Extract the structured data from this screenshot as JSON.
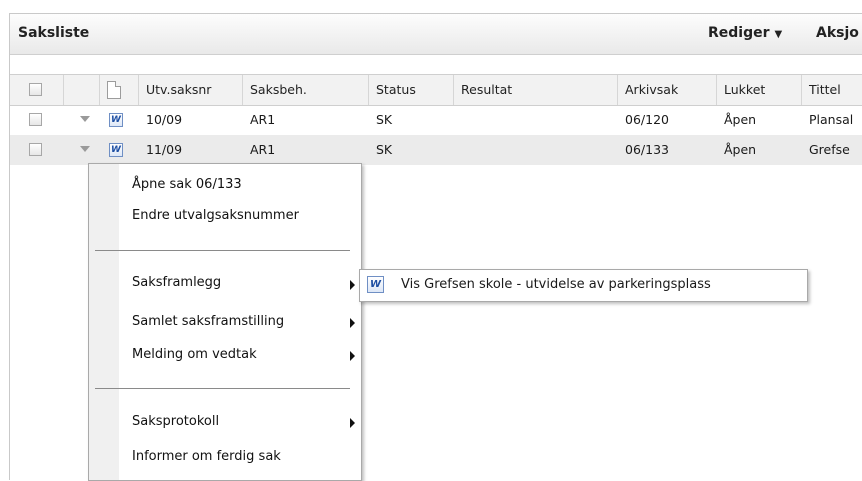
{
  "panel": {
    "title": "Saksliste",
    "menus": [
      {
        "label": "Rediger"
      },
      {
        "label": "Aksjo"
      }
    ]
  },
  "table": {
    "columns": [
      "Utv.saksnr",
      "Saksbeh.",
      "Status",
      "Resultat",
      "Arkivsak",
      "Lukket",
      "Tittel"
    ],
    "rows": [
      {
        "utvsaksnr": "10/09",
        "saksbeh": "AR1",
        "status": "SK",
        "resultat": "",
        "arkivsak": "06/120",
        "lukket": "Åpen",
        "tittel": "Plansal"
      },
      {
        "utvsaksnr": "11/09",
        "saksbeh": "AR1",
        "status": "SK",
        "resultat": "",
        "arkivsak": "06/133",
        "lukket": "Åpen",
        "tittel": "Grefse"
      }
    ]
  },
  "context_menu": {
    "items": [
      {
        "label": "Åpne sak 06/133"
      },
      {
        "label": "Endre utvalgsaksnummer"
      },
      {
        "label": "Saksframlegg"
      },
      {
        "label": "Samlet saksframstilling"
      },
      {
        "label": "Melding om vedtak"
      },
      {
        "label": "Saksprotokoll"
      },
      {
        "label": "Informer om ferdig sak"
      }
    ]
  },
  "submenu": {
    "label": "Vis Grefsen skole - utvidelse av parkeringsplass",
    "icon": "word-document-icon"
  },
  "colors": {
    "selected_row": "#ebebeb",
    "header_bg": "#f2f2f2"
  }
}
